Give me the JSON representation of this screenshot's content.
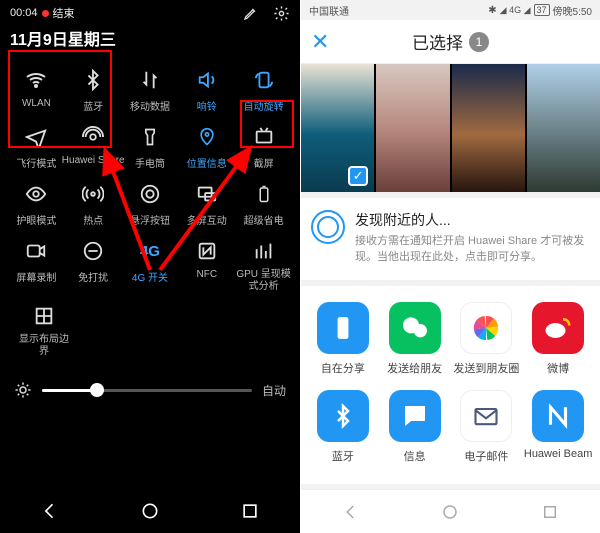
{
  "left": {
    "status": {
      "time": "00:04",
      "rec_label": "结束"
    },
    "date": "11月9日星期三",
    "tiles": [
      {
        "key": "wlan",
        "label": "WLAN",
        "on": false
      },
      {
        "key": "bt",
        "label": "蓝牙",
        "on": false
      },
      {
        "key": "data",
        "label": "移动数据",
        "on": false
      },
      {
        "key": "ring",
        "label": "响铃",
        "on": true
      },
      {
        "key": "rotate",
        "label": "自动旋转",
        "on": true
      },
      {
        "key": "airplane",
        "label": "飞行模式",
        "on": false
      },
      {
        "key": "hshare",
        "label": "Huawei Share",
        "on": false
      },
      {
        "key": "torch",
        "label": "手电筒",
        "on": false
      },
      {
        "key": "location",
        "label": "位置信息",
        "on": true
      },
      {
        "key": "shot",
        "label": "截屏",
        "on": false
      },
      {
        "key": "eye",
        "label": "护眼模式",
        "on": false
      },
      {
        "key": "hotspot",
        "label": "热点",
        "on": false
      },
      {
        "key": "float",
        "label": "悬浮按钮",
        "on": false
      },
      {
        "key": "cast",
        "label": "多屏互动",
        "on": false
      },
      {
        "key": "ultra",
        "label": "超级省电",
        "on": false
      },
      {
        "key": "record",
        "label": "屏幕录制",
        "on": false
      },
      {
        "key": "dnd",
        "label": "免打扰",
        "on": false
      },
      {
        "key": "4g",
        "label": "4G 开关",
        "on": true
      },
      {
        "key": "nfc",
        "label": "NFC",
        "on": false
      },
      {
        "key": "gpu",
        "label": "GPU 呈现模式分析",
        "on": false
      },
      {
        "key": "bounds",
        "label": "显示布局边界",
        "on": false
      }
    ],
    "brightness": {
      "auto_label": "自动",
      "value_percent": 26
    }
  },
  "right": {
    "status": {
      "carrier": "中国联通",
      "battery": "37",
      "time": "傍晚5:50"
    },
    "header": {
      "title": "已选择",
      "count": "1"
    },
    "gallery": {
      "selected_index": 0
    },
    "nearby": {
      "title": "发现附近的人...",
      "desc": "接收方需在通知栏开启 Huawei Share 才可被发现。当他出现在此处，点击即可分享。"
    },
    "apps": [
      {
        "key": "zizai",
        "label": "自在分享",
        "bg": "#2196f3"
      },
      {
        "key": "wechat",
        "label": "发送给朋友",
        "bg": "#07c160"
      },
      {
        "key": "moments",
        "label": "发送到朋友圈",
        "bg": "#ffffff"
      },
      {
        "key": "weibo",
        "label": "微博",
        "bg": "#e6162d"
      },
      {
        "key": "bt",
        "label": "蓝牙",
        "bg": "#2196f3"
      },
      {
        "key": "msg",
        "label": "信息",
        "bg": "#2196f3"
      },
      {
        "key": "mail",
        "label": "电子邮件",
        "bg": "#ffffff"
      },
      {
        "key": "beam",
        "label": "Huawei Beam",
        "bg": "#2196f3"
      }
    ]
  }
}
